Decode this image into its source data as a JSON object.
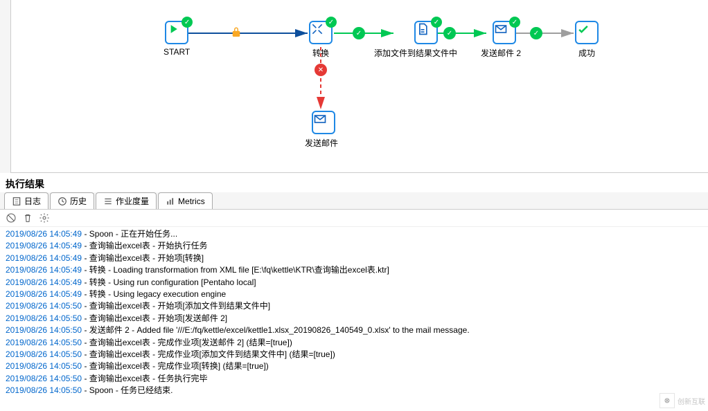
{
  "canvas": {
    "nodes": {
      "start": {
        "label": "START"
      },
      "transform": {
        "label": "转换"
      },
      "addfile": {
        "label": "添加文件到结果文件中"
      },
      "sendmail2": {
        "label": "发送邮件 2"
      },
      "success": {
        "label": "成功"
      },
      "sendmail": {
        "label": "发送邮件"
      }
    }
  },
  "results_title": "执行结果",
  "tabs": {
    "log": "日志",
    "history": "历史",
    "metrics_job": "作业度量",
    "metrics": "Metrics"
  },
  "log_lines": [
    {
      "ts": "2019/08/26 14:05:49",
      "msg": "Spoon - 正在开始任务..."
    },
    {
      "ts": "2019/08/26 14:05:49",
      "msg": "查询输出excel表 - 开始执行任务"
    },
    {
      "ts": "2019/08/26 14:05:49",
      "msg": "查询输出excel表 - 开始项[转换]"
    },
    {
      "ts": "2019/08/26 14:05:49",
      "msg": "转换 - Loading transformation from XML file [E:\\fq\\kettle\\KTR\\查询输出excel表.ktr]"
    },
    {
      "ts": "2019/08/26 14:05:49",
      "msg": "转换 - Using run configuration [Pentaho local]"
    },
    {
      "ts": "2019/08/26 14:05:49",
      "msg": "转换 - Using legacy execution engine"
    },
    {
      "ts": "2019/08/26 14:05:50",
      "msg": "查询输出excel表 - 开始项[添加文件到结果文件中]"
    },
    {
      "ts": "2019/08/26 14:05:50",
      "msg": "查询输出excel表 - 开始项[发送邮件 2]"
    },
    {
      "ts": "2019/08/26 14:05:50",
      "msg": "发送邮件 2 - Added file '///E:/fq/kettle/excel/kettle1.xlsx_20190826_140549_0.xlsx' to the mail message."
    },
    {
      "ts": "2019/08/26 14:05:50",
      "msg": "查询输出excel表 - 完成作业项[发送邮件 2] (结果=[true])"
    },
    {
      "ts": "2019/08/26 14:05:50",
      "msg": "查询输出excel表 - 完成作业项[添加文件到结果文件中] (结果=[true])"
    },
    {
      "ts": "2019/08/26 14:05:50",
      "msg": "查询输出excel表 - 完成作业项[转换] (结果=[true])"
    },
    {
      "ts": "2019/08/26 14:05:50",
      "msg": "查询输出excel表 - 任务执行完毕"
    },
    {
      "ts": "2019/08/26 14:05:50",
      "msg": "Spoon - 任务已经结束."
    }
  ],
  "watermark": {
    "logo_text": "⊗",
    "text": "创新互联"
  }
}
